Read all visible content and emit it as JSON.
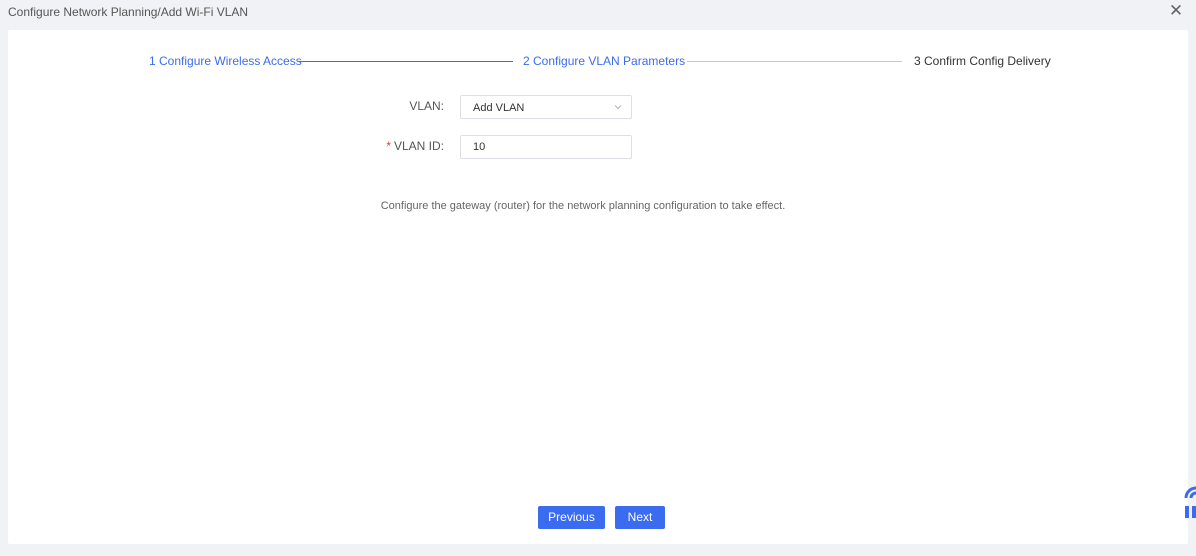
{
  "header": {
    "title": "Configure Network Planning/Add Wi-Fi VLAN",
    "close_icon": "close-icon"
  },
  "steps": [
    {
      "label": "1 Configure Wireless Access",
      "state": "done"
    },
    {
      "label": "2 Configure VLAN Parameters",
      "state": "active"
    },
    {
      "label": "3 Confirm Config Delivery",
      "state": "todo"
    }
  ],
  "form": {
    "vlan": {
      "label": "VLAN:",
      "value": "Add VLAN"
    },
    "vlan_id": {
      "required_mark": "*",
      "label": "VLAN ID:",
      "value": "10"
    }
  },
  "hint": "Configure the gateway (router) for the network planning configuration to take effect.",
  "buttons": {
    "previous": "Previous",
    "next": "Next"
  },
  "colors": {
    "accent": "#3b6cf0",
    "required": "#e53935"
  }
}
